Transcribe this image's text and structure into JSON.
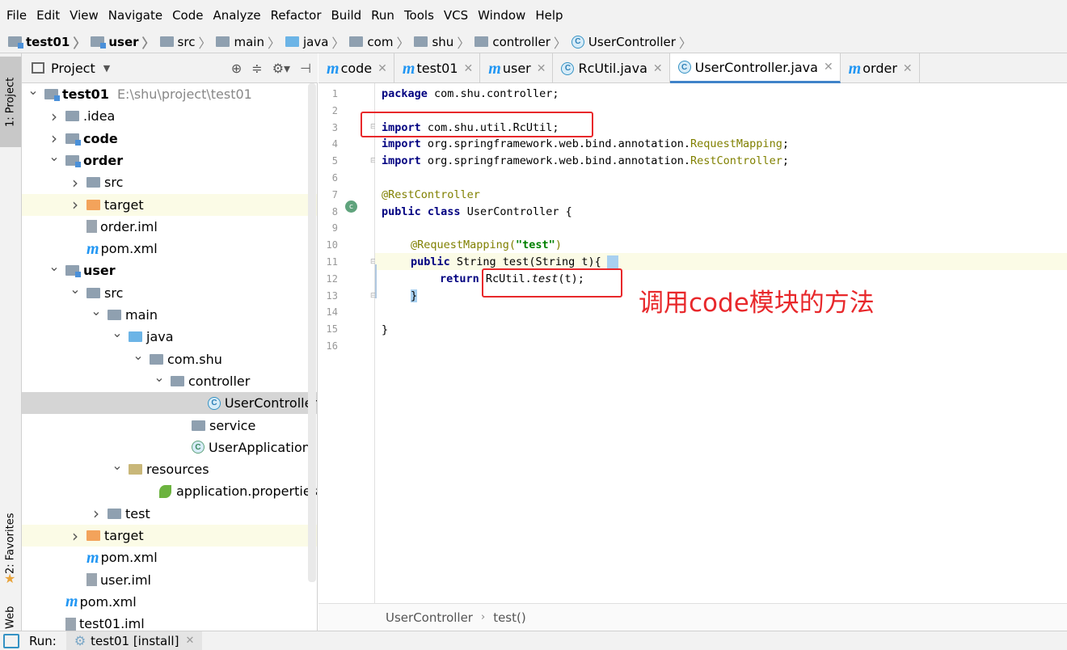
{
  "menubar": {
    "items": [
      "File",
      "Edit",
      "View",
      "Navigate",
      "Code",
      "Analyze",
      "Refactor",
      "Build",
      "Run",
      "Tools",
      "VCS",
      "Window",
      "Help"
    ]
  },
  "navbar": {
    "crumbs": [
      {
        "label": "test01",
        "bold": true,
        "icon": "module-folder-icon"
      },
      {
        "label": "user",
        "bold": true,
        "icon": "module-folder-icon"
      },
      {
        "label": "src",
        "icon": "folder-icon"
      },
      {
        "label": "main",
        "icon": "folder-icon"
      },
      {
        "label": "java",
        "icon": "source-folder-icon"
      },
      {
        "label": "com",
        "icon": "package-icon"
      },
      {
        "label": "shu",
        "icon": "package-icon"
      },
      {
        "label": "controller",
        "icon": "package-icon"
      },
      {
        "label": "UserController",
        "icon": "class-icon"
      }
    ]
  },
  "sidebar": {
    "project_tab": "1: Project",
    "favorites_tab": "2: Favorites",
    "web_tab": "Web"
  },
  "project_panel": {
    "title": "Project",
    "tree": [
      {
        "label": "test01",
        "hint": "E:\\shu\\project\\test01",
        "bold": true,
        "icon": "module-folder-icon",
        "depth": 0,
        "arrow": "down"
      },
      {
        "label": ".idea",
        "icon": "folder-icon",
        "depth": 1,
        "arrow": "right"
      },
      {
        "label": "code",
        "bold": true,
        "icon": "module-folder-icon",
        "depth": 1,
        "arrow": "right"
      },
      {
        "label": "order",
        "bold": true,
        "icon": "module-folder-icon",
        "depth": 1,
        "arrow": "down"
      },
      {
        "label": "src",
        "icon": "folder-icon",
        "depth": 2,
        "arrow": "right"
      },
      {
        "label": "target",
        "icon": "excluded-folder-icon",
        "depth": 2,
        "arrow": "right",
        "highlight": true
      },
      {
        "label": "order.iml",
        "icon": "iml-file-icon",
        "depth": 2,
        "arrow": ""
      },
      {
        "label": "pom.xml",
        "icon": "maven-icon",
        "depth": 2,
        "arrow": ""
      },
      {
        "label": "user",
        "bold": true,
        "icon": "module-folder-icon",
        "depth": 1,
        "arrow": "down"
      },
      {
        "label": "src",
        "icon": "folder-icon",
        "depth": 2,
        "arrow": "down"
      },
      {
        "label": "main",
        "icon": "folder-icon",
        "depth": 3,
        "arrow": "down"
      },
      {
        "label": "java",
        "icon": "source-folder-icon",
        "depth": 4,
        "arrow": "down"
      },
      {
        "label": "com.shu",
        "icon": "package-icon",
        "depth": 5,
        "arrow": "down"
      },
      {
        "label": "controller",
        "icon": "package-icon",
        "depth": 6,
        "arrow": "down"
      },
      {
        "label": "UserController",
        "icon": "class-icon",
        "depth": 8,
        "arrow": "",
        "selected": true
      },
      {
        "label": "service",
        "icon": "package-icon",
        "depth": 7,
        "arrow": ""
      },
      {
        "label": "UserApplication",
        "icon": "spring-class-icon",
        "depth": 7,
        "arrow": ""
      },
      {
        "label": "resources",
        "icon": "resources-folder-icon",
        "depth": 4,
        "arrow": "down"
      },
      {
        "label": "application.properties",
        "icon": "spring-properties-icon",
        "depth": 6,
        "arrow": ""
      },
      {
        "label": "test",
        "icon": "folder-icon",
        "depth": 3,
        "arrow": "right"
      },
      {
        "label": "target",
        "icon": "excluded-folder-icon",
        "depth": 2,
        "arrow": "right",
        "highlight": true
      },
      {
        "label": "pom.xml",
        "icon": "maven-icon",
        "depth": 2,
        "arrow": ""
      },
      {
        "label": "user.iml",
        "icon": "iml-file-icon",
        "depth": 2,
        "arrow": ""
      },
      {
        "label": "pom.xml",
        "icon": "maven-icon",
        "depth": 1,
        "arrow": ""
      },
      {
        "label": "test01.iml",
        "icon": "iml-file-icon",
        "depth": 1,
        "arrow": ""
      }
    ]
  },
  "editor": {
    "tabs": [
      {
        "label": "code",
        "icon": "maven-icon"
      },
      {
        "label": "test01",
        "icon": "maven-icon"
      },
      {
        "label": "user",
        "icon": "maven-icon"
      },
      {
        "label": "RcUtil.java",
        "icon": "class-icon"
      },
      {
        "label": "UserController.java",
        "icon": "class-icon",
        "active": true
      },
      {
        "label": "order",
        "icon": "maven-icon"
      }
    ],
    "line_numbers": [
      "1",
      "2",
      "3",
      "4",
      "5",
      "6",
      "7",
      "8",
      "9",
      "10",
      "11",
      "12",
      "13",
      "14",
      "15",
      "16"
    ],
    "code": {
      "l1_kw": "package",
      "l1_rest": " com.shu.controller;",
      "l3_kw": "import",
      "l3_rest": " com.shu.util.RcUtil;",
      "l4_kw": "import",
      "l4_pkg": " org.springframework.web.bind.annotation.",
      "l4_cls": "RequestMapping",
      "l4_end": ";",
      "l5_kw": "import",
      "l5_pkg": " org.springframework.web.bind.annotation.",
      "l5_cls": "RestController",
      "l5_end": ";",
      "l7_ann": "@RestController",
      "l8_kw1": "public",
      "l8_kw2": "class",
      "l8_rest": " UserController {",
      "l10_ann": "@RequestMapping(",
      "l10_str": "\"test\"",
      "l10_end": ")",
      "l11_kw": "public",
      "l11_rest": " String test(String t){",
      "l12_kw": "return",
      "l12_a": " RcUtil.",
      "l12_b": "test",
      "l12_c": "(t);",
      "l13": "}",
      "l15": "}"
    },
    "annotation_note": "调用code模块的方法",
    "breadcrumb": [
      "UserController",
      "test()"
    ]
  },
  "runbar": {
    "label": "Run:",
    "config": "test01 [install]"
  },
  "colors": {
    "keyword": "#000080",
    "annotation": "#808000",
    "string": "#008000",
    "red_box": "#e8282b",
    "selection": "#d5d5d5",
    "highlight": "#fbfbe6"
  }
}
